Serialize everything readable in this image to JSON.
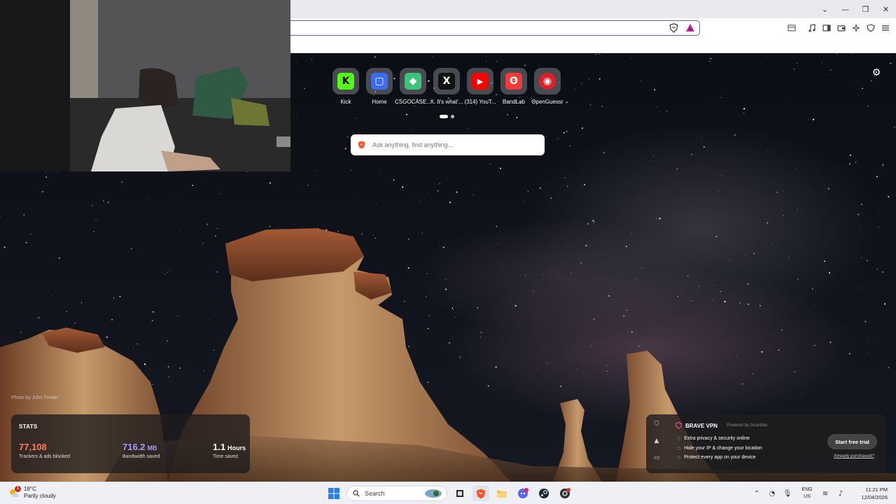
{
  "browser": {
    "window_controls": [
      "chevron-down-icon",
      "minimize-icon",
      "restore-icon",
      "close-icon"
    ],
    "url_bar": {
      "value": ""
    },
    "toolbar_icons": [
      "tab-strip-icon",
      "music-icon",
      "sidebar-icon",
      "wallet-icon",
      "leo-ai-icon",
      "vpn-icon",
      "menu-icon"
    ]
  },
  "new_tab": {
    "top_sites": [
      {
        "label": "Kick",
        "icon": "kick-icon",
        "color": "#53fc18",
        "glyph": "K"
      },
      {
        "label": "Home",
        "icon": "home-icon",
        "color": "#3a6cf4",
        "glyph": "▢"
      },
      {
        "label": "CSGOCASE...",
        "icon": "csgocases-icon",
        "color": "#3ec47a",
        "glyph": "◆"
      },
      {
        "label": "X. It's what'...",
        "icon": "x-icon",
        "color": "#111111",
        "glyph": "X"
      },
      {
        "label": "(314) YouT...",
        "icon": "youtube-icon",
        "color": "#ff0000",
        "glyph": "▶"
      },
      {
        "label": "BandLab",
        "icon": "bandlab-icon",
        "color": "#f23a3a",
        "glyph": "ʘ"
      },
      {
        "label": "OpenGuessr",
        "icon": "openguessr-icon",
        "color": "#e01e2a",
        "glyph": "◉"
      }
    ],
    "search": {
      "placeholder": "Ask anything, find anything..."
    },
    "photo_credit": "Photo by John Fowler",
    "stats": {
      "title": "STATS",
      "trackers": {
        "value": "77,108",
        "label": "Trackers & ads blocked",
        "color": "#ff7a55"
      },
      "bandwidth": {
        "value": "716.2",
        "unit": "MB",
        "label": "Bandwidth saved",
        "color": "#a59cff"
      },
      "time": {
        "value": "1.1",
        "unit": "Hours",
        "label": "Time saved",
        "color": "#ffffff"
      }
    },
    "vpn": {
      "title": "BRAVE VPN",
      "powered": "Powered by Guardian",
      "features": [
        "Extra privacy & security online",
        "Hide your IP & change your location",
        "Protect every app on your device"
      ],
      "button": "Start free trial",
      "link": "Already purchased?"
    }
  },
  "taskbar": {
    "weather": {
      "temp": "18°C",
      "desc": "Partly cloudy",
      "badge": "1"
    },
    "search_label": "Search",
    "apps": [
      "task-view-icon",
      "brave-icon",
      "file-explorer-icon",
      "discord-icon",
      "steam-icon",
      "obs-icon"
    ],
    "lang": {
      "line1": "ENG",
      "line2": "US"
    },
    "time": "11:21 PM",
    "date": "12/04/2026"
  }
}
